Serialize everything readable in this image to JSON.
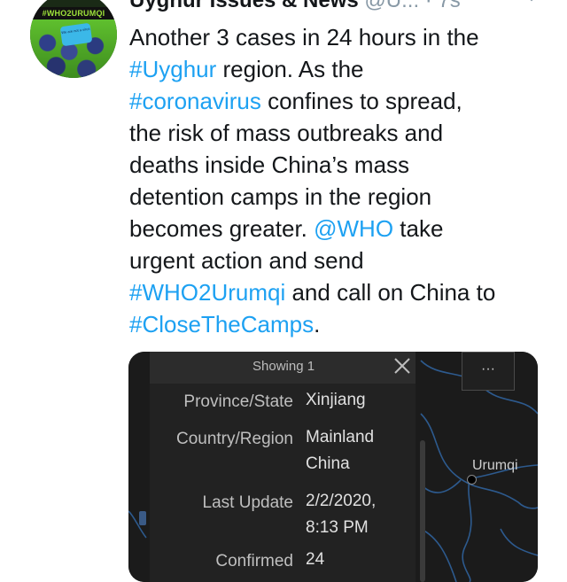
{
  "tweet": {
    "author_name": "Uyghur Issues & News",
    "author_handle": "@U...",
    "separator": " · ",
    "timestamp": "7s",
    "avatar_banner_text": "#WHO2URUMQI",
    "avatar_sign_text": "We are not a virus",
    "text_lines": [
      [
        {
          "t": "Another 3 cases in 24 hours in the",
          "link": false
        }
      ],
      [
        {
          "t": "#Uyghur",
          "link": true
        },
        {
          "t": " region. As the",
          "link": false
        }
      ],
      [
        {
          "t": "#coronavirus",
          "link": true
        },
        {
          "t": " confines to spread,",
          "link": false
        }
      ],
      [
        {
          "t": "the risk of mass outbreaks and",
          "link": false
        }
      ],
      [
        {
          "t": "deaths inside China’s mass",
          "link": false
        }
      ],
      [
        {
          "t": "detention camps in the region",
          "link": false
        }
      ],
      [
        {
          "t": "becomes greater. ",
          "link": false
        },
        {
          "t": "@WHO",
          "link": true
        },
        {
          "t": " take",
          "link": false
        }
      ],
      [
        {
          "t": "urgent action and send",
          "link": false
        }
      ],
      [
        {
          "t": "#WHO2Urumqi",
          "link": true
        },
        {
          "t": " and call on China to",
          "link": false
        }
      ],
      [
        {
          "t": "#CloseTheCamps",
          "link": true
        },
        {
          "t": ".",
          "link": false
        }
      ]
    ]
  },
  "media": {
    "popup_title": "Showing 1",
    "more_button_label": "···",
    "city_label": "Urumqi",
    "fields": [
      {
        "label": "Province/State",
        "value_lines": [
          "Xinjiang"
        ]
      },
      {
        "label": "Country/Region",
        "value_lines": [
          "Mainland",
          "China"
        ]
      },
      {
        "label": "Last Update",
        "value_lines": [
          "2/2/2020,",
          "8:13 PM"
        ]
      },
      {
        "label": "Confirmed",
        "value_lines": [
          "24"
        ]
      }
    ]
  },
  "colors": {
    "link": "#1da1f2",
    "text": "#14171a",
    "muted": "#8899a6",
    "map_background": "#1b1b1b",
    "map_roads": "#2d5a8e"
  },
  "icons": {
    "chevron": "chevron-down-icon",
    "close": "close-icon",
    "more": "more-horizontal-icon"
  }
}
